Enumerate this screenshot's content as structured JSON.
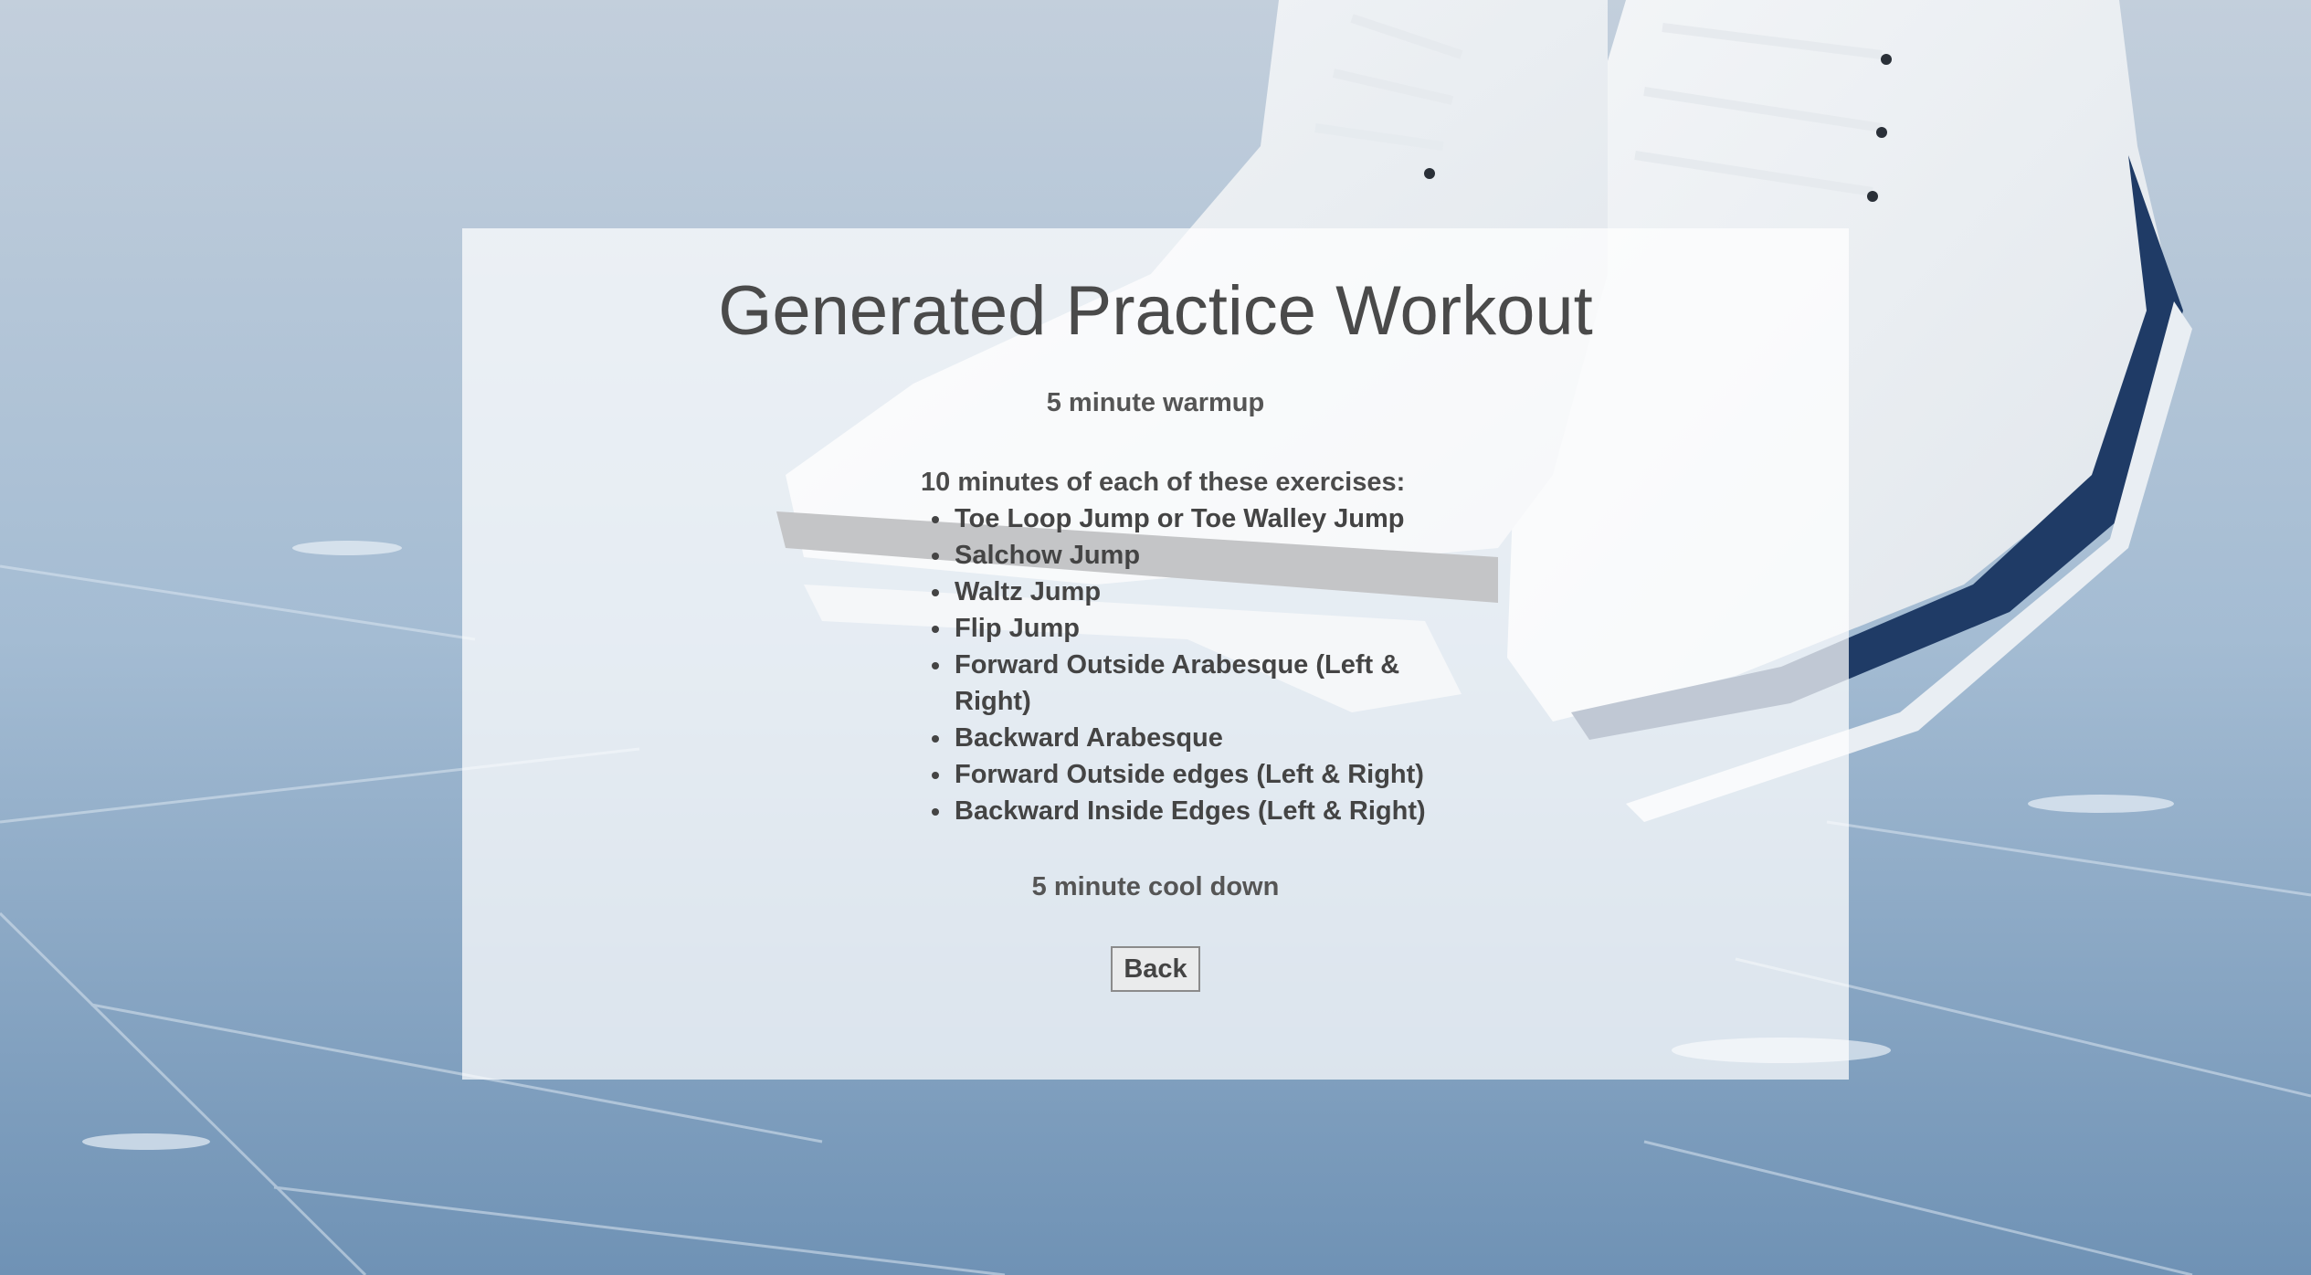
{
  "page": {
    "title": "Generated Practice Workout",
    "warmup": "5 minute warmup",
    "exercises_heading": "10 minutes of each of these exercises:",
    "exercises": [
      "Toe Loop Jump or Toe Walley Jump",
      "Salchow Jump",
      "Waltz Jump",
      "Flip Jump",
      "Forward Outside Arabesque (Left & Right)",
      "Backward Arabesque",
      "Forward Outside edges (Left & Right)",
      "Backward Inside Edges (Left & Right)"
    ],
    "cooldown": "5 minute cool down",
    "back_label": "Back"
  },
  "background": {
    "description_icon": "ice-skates-photo",
    "colors": {
      "ice": "#9cb7cf",
      "panel": "#ffffff"
    }
  }
}
